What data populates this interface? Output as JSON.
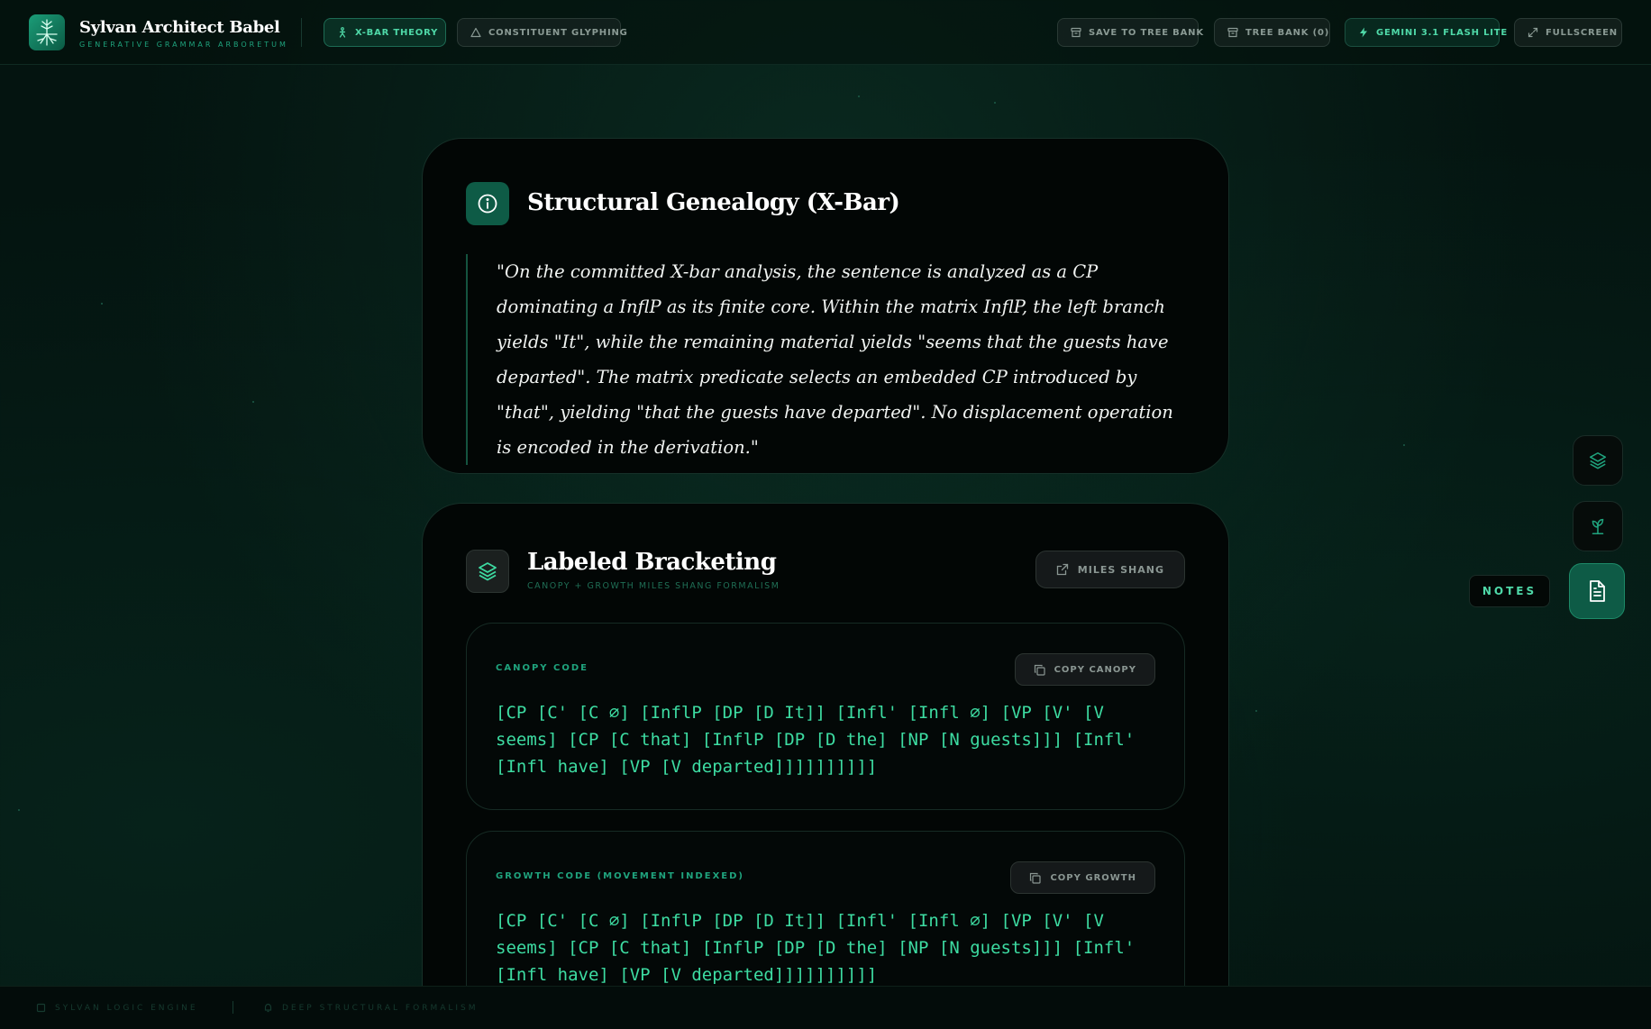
{
  "header": {
    "brand_title": "Sylvan Architect Babel",
    "brand_subtitle": "GENERATIVE GRAMMAR ARBORETUM",
    "tabs": [
      {
        "label": "X-BAR THEORY",
        "active": true,
        "icon": "person-tree-icon"
      },
      {
        "label": "CONSTITUENT GLYPHING",
        "active": false,
        "icon": "triangle-icon"
      }
    ],
    "actions": {
      "save_label": "SAVE TO TREE BANK",
      "tree_bank_label": "TREE BANK (0)",
      "model_label": "GEMINI 3.1 FLASH LITE",
      "fullscreen_label": "FULLSCREEN"
    }
  },
  "genealogy": {
    "title": "Structural Genealogy (X-Bar)",
    "quote": "\"On the committed X-bar analysis, the sentence is analyzed as a CP dominating a InflP as its finite core. Within the matrix InflP, the left branch yields \"It\", while the remaining material yields \"seems that the guests have departed\". The matrix predicate selects an embedded CP introduced by \"that\", yielding \"that the guests have departed\". No displacement operation is encoded in the derivation.\""
  },
  "bracketing": {
    "title": "Labeled Bracketing",
    "subtitle": "CANOPY + GROWTH MILES SHANG FORMALISM",
    "author_label": "MILES SHANG",
    "canopy": {
      "label": "CANOPY CODE",
      "copy_label": "COPY CANOPY",
      "code": "[CP [C' [C ∅] [InflP [DP [D It]] [Infl' [Infl ∅] [VP [V' [V seems] [CP [C that] [InflP [DP [D the] [NP [N guests]]] [Infl' [Infl have] [VP [V departed]]]]]]]]]]"
    },
    "growth": {
      "label": "GROWTH CODE (MOVEMENT INDEXED)",
      "copy_label": "COPY GROWTH",
      "code": "[CP [C' [C ∅] [InflP [DP [D It]] [Infl' [Infl ∅] [VP [V' [V seems] [CP [C that] [InflP [DP [D the] [NP [N guests]]] [Infl' [Infl have] [VP [V departed]]]]]]]]]]"
    }
  },
  "rail": {
    "notes_label": "NOTES"
  },
  "footer": {
    "engine_label": "SYLVAN LOGIC ENGINE",
    "formalism_label": "DEEP STRUCTURAL FORMALISM"
  },
  "colors": {
    "accent": "#3ddca2",
    "accent_dim": "#1fa37d",
    "brand_teal": "#0e5b46",
    "background": "#041410"
  }
}
